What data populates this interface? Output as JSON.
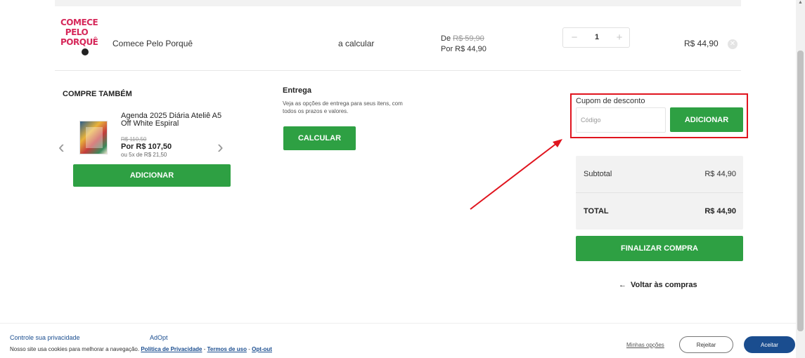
{
  "cart": {
    "item": {
      "thumb_lines": [
        "COMECE",
        "PELO",
        "PORQUÊ"
      ],
      "name": "Comece Pelo Porquê",
      "shipping": "a calcular",
      "price_from_label": "De",
      "price_from_value": "R$ 59,90",
      "price_to": "Por R$ 44,90",
      "quantity": "1",
      "minus_symbol": "−",
      "plus_symbol": "+",
      "total": "R$ 44,90",
      "remove_symbol": "✕"
    }
  },
  "cross_sell": {
    "title": "COMPRE TAMBÉM",
    "prev_symbol": "‹",
    "next_symbol": "›",
    "product": {
      "name": "Agenda 2025 Diária Ateliê A5 Off White Espiral",
      "old_price": "R$ 110,50",
      "price": "Por R$ 107,50",
      "installments": "ou 5x de R$ 21,50"
    },
    "add_label": "ADICIONAR"
  },
  "delivery": {
    "title": "Entrega",
    "description": "Veja as opções de entrega para seus itens, com todos os prazos e valores.",
    "calc_label": "CALCULAR"
  },
  "coupon": {
    "label": "Cupom de desconto",
    "placeholder": "Código",
    "add_label": "ADICIONAR",
    "highlight_color": "#e0141e"
  },
  "summary": {
    "subtotal_label": "Subtotal",
    "subtotal_value": "R$ 44,90",
    "total_label": "TOTAL",
    "total_value": "R$ 44,90",
    "finish_label": "FINALIZAR COMPRA",
    "back_arrow": "←",
    "back_label": "Voltar às compras"
  },
  "cookie": {
    "title": "Controle sua privacidade",
    "brand": "AdOpt",
    "text": "Nosso site usa cookies para melhorar a navegação.",
    "privacy_link": "Política de Privacidade",
    "terms_link": "Termos de uso",
    "optout_link": "Opt-out",
    "separator": "-",
    "options_label": "Minhas opções",
    "reject_label": "Rejeitar",
    "accept_label": "Aceitar"
  },
  "scrollbar": {
    "up_symbol": "▲"
  },
  "colors": {
    "primary_green": "#2ea043",
    "link_blue": "#1a4d8f",
    "annotation_red": "#e0141e"
  }
}
